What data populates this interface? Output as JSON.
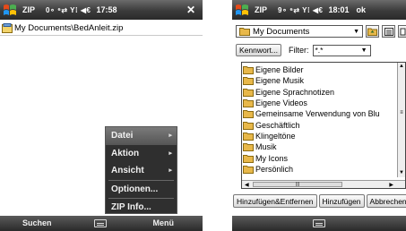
{
  "left": {
    "title": "ZIP",
    "status": "0∘ ⁶⇄ Y⁞ ◀€",
    "time": "17:58",
    "close_label": "✕",
    "path": "My Documents\\BedAnleit.zip",
    "menu": {
      "items": [
        {
          "label": "Datei",
          "arrow": "▸"
        },
        {
          "label": "Aktion",
          "arrow": "▸"
        },
        {
          "label": "Ansicht",
          "arrow": "▸"
        },
        {
          "label": "Optionen..."
        },
        {
          "label": "ZIP Info..."
        }
      ]
    },
    "softkeys": {
      "left": "Suchen",
      "right": "Menü"
    }
  },
  "right": {
    "title": "ZIP",
    "status": "9∘ ⁶⇄ Y⁞ ◀€",
    "time": "18:01",
    "ok_label": "ok",
    "folder": "My Documents",
    "password_button": "Kennwort...",
    "filter_label": "Filter:",
    "filter_value": "*.*",
    "files": [
      "Eigene Bilder",
      "Eigene Musik",
      "Eigene Sprachnotizen",
      "Eigene Videos",
      "Gemeinsame Verwendung von Blu",
      "Geschäftlich",
      "Klingeltöne",
      "Musik",
      "My Icons",
      "Persönlich"
    ],
    "buttons": [
      "Hinzufügen&Entfernen",
      "Hinzufügen",
      "Abbrechen"
    ]
  },
  "colors": {
    "titlebar": "#3b3b3b",
    "menu_bg": "#2f2f2f",
    "folder": "#e8b84a"
  }
}
